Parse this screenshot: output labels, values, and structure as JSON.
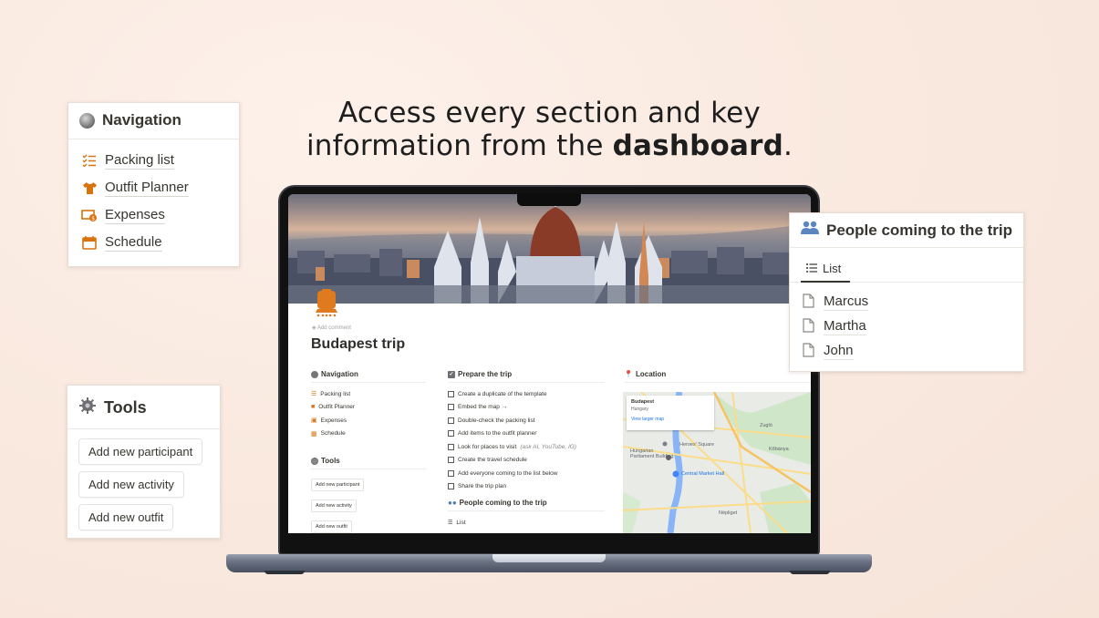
{
  "headline": {
    "line1": "Access every section and key",
    "line2_prefix": "information from the ",
    "line2_bold": "dashboard",
    "line2_suffix": "."
  },
  "navigation_card": {
    "title": "Navigation",
    "items": [
      {
        "label": "Packing list",
        "icon": "checklist-icon"
      },
      {
        "label": "Outfit Planner",
        "icon": "shirt-icon"
      },
      {
        "label": "Expenses",
        "icon": "money-icon"
      },
      {
        "label": "Schedule",
        "icon": "calendar-icon"
      }
    ]
  },
  "tools_card": {
    "title": "Tools",
    "buttons": [
      "Add new participant",
      "Add new activity",
      "Add new outfit"
    ]
  },
  "people_card": {
    "title": "People coming to the trip",
    "tab": "List",
    "people": [
      "Marcus",
      "Martha",
      "John"
    ]
  },
  "dashboard": {
    "add_comment": "Add comment",
    "page_title": "Budapest trip",
    "navigation": {
      "title": "Navigation",
      "items": [
        "Packing list",
        "Outfit Planner",
        "Expenses",
        "Schedule"
      ]
    },
    "tools": {
      "title": "Tools",
      "buttons": [
        "Add new participant",
        "Add new activity",
        "Add new outfit"
      ]
    },
    "prepare": {
      "title": "Prepare the trip",
      "tasks": [
        "Create a duplicate of the template",
        "Embed the map →",
        "Double-check the packing list",
        "Add items to the outfit planner",
        "Look for places to visit",
        "Create the travel schedule",
        "Add everyone coming to the list below",
        "Share the trip plan"
      ],
      "task5_note": "(ask AI, YouTube, IG)"
    },
    "people": {
      "title": "People coming to the trip",
      "tab": "List"
    },
    "location": {
      "title": "Location",
      "map_popup_title": "Budapest",
      "map_popup_subtitle": "Hungary",
      "map_popup_link": "View larger map",
      "map_labels": [
        "Heroes' Square",
        "Hungarian Parliament Building",
        "Central Market Hall",
        "Zugló",
        "Kőbánya",
        "Népliget"
      ]
    }
  },
  "colors": {
    "accent_orange": "#d9730d",
    "text": "#37352f",
    "background": "#f9e9df"
  }
}
